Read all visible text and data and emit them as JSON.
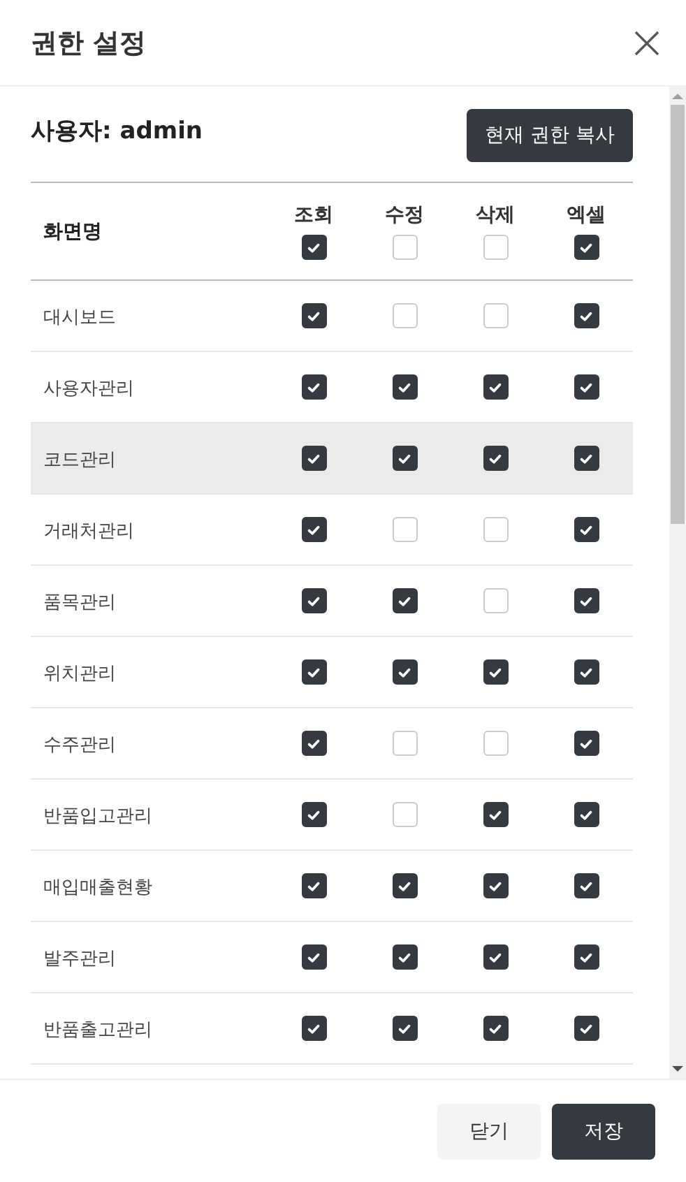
{
  "dialog": {
    "title": "권한 설정"
  },
  "user_label": "사용자: admin",
  "copy_button": "현재 권한 복사",
  "table": {
    "name_header": "화면명",
    "columns": [
      {
        "label": "조회",
        "checked": true
      },
      {
        "label": "수정",
        "checked": false
      },
      {
        "label": "삭제",
        "checked": false
      },
      {
        "label": "엑셀",
        "checked": true
      }
    ],
    "rows": [
      {
        "name": "대시보드",
        "selected": false,
        "cells": [
          {
            "checked": true
          },
          {
            "checked": false
          },
          {
            "checked": false
          },
          {
            "checked": true
          }
        ]
      },
      {
        "name": "사용자관리",
        "selected": false,
        "cells": [
          {
            "checked": true
          },
          {
            "checked": true
          },
          {
            "checked": true
          },
          {
            "checked": true
          }
        ]
      },
      {
        "name": "코드관리",
        "selected": true,
        "cells": [
          {
            "checked": true
          },
          {
            "checked": true
          },
          {
            "checked": true
          },
          {
            "checked": true
          }
        ]
      },
      {
        "name": "거래처관리",
        "selected": false,
        "cells": [
          {
            "checked": true
          },
          {
            "checked": false
          },
          {
            "checked": false
          },
          {
            "checked": true
          }
        ]
      },
      {
        "name": "품목관리",
        "selected": false,
        "cells": [
          {
            "checked": true
          },
          {
            "checked": true
          },
          {
            "checked": false
          },
          {
            "checked": true
          }
        ]
      },
      {
        "name": "위치관리",
        "selected": false,
        "cells": [
          {
            "checked": true
          },
          {
            "checked": true
          },
          {
            "checked": true
          },
          {
            "checked": true
          }
        ]
      },
      {
        "name": "수주관리",
        "selected": false,
        "cells": [
          {
            "checked": true
          },
          {
            "checked": false
          },
          {
            "checked": false
          },
          {
            "checked": true
          }
        ]
      },
      {
        "name": "반품입고관리",
        "selected": false,
        "cells": [
          {
            "checked": true
          },
          {
            "checked": false
          },
          {
            "checked": true
          },
          {
            "checked": true
          }
        ]
      },
      {
        "name": "매입매출현황",
        "selected": false,
        "cells": [
          {
            "checked": true
          },
          {
            "checked": true
          },
          {
            "checked": true
          },
          {
            "checked": true
          }
        ]
      },
      {
        "name": "발주관리",
        "selected": false,
        "cells": [
          {
            "checked": true
          },
          {
            "checked": true
          },
          {
            "checked": true
          },
          {
            "checked": true
          }
        ]
      },
      {
        "name": "반품출고관리",
        "selected": false,
        "cells": [
          {
            "checked": true
          },
          {
            "checked": true
          },
          {
            "checked": true
          },
          {
            "checked": true
          }
        ]
      }
    ]
  },
  "buttons": {
    "close": "닫기",
    "save": "저장"
  }
}
